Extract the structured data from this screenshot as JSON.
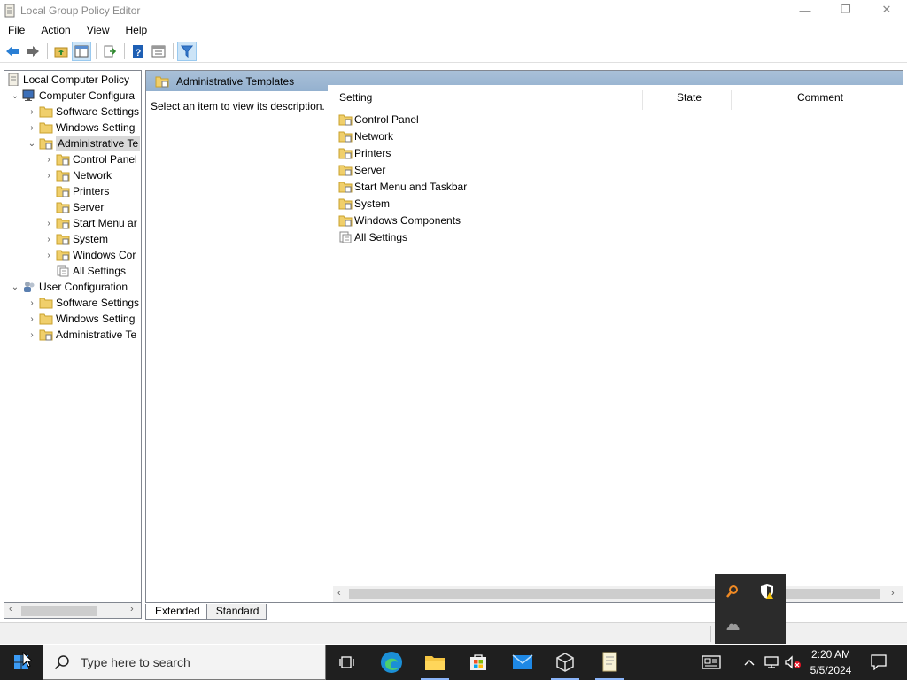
{
  "window": {
    "title": "Local Group Policy Editor",
    "minimize": "—",
    "restore": "❐",
    "close": "✕"
  },
  "menu": [
    "File",
    "Action",
    "View",
    "Help"
  ],
  "tree": {
    "items": [
      {
        "label": "Local Computer Policy",
        "expander": ""
      },
      {
        "label": "Computer Configura",
        "expander": "⌄"
      },
      {
        "label": "Software Settings",
        "expander": "›"
      },
      {
        "label": "Windows Setting",
        "expander": "›"
      },
      {
        "label": "Administrative Te",
        "expander": "⌄"
      },
      {
        "label": "Control Panel",
        "expander": "›"
      },
      {
        "label": "Network",
        "expander": "›"
      },
      {
        "label": "Printers",
        "expander": ""
      },
      {
        "label": "Server",
        "expander": ""
      },
      {
        "label": "Start Menu ar",
        "expander": "›"
      },
      {
        "label": "System",
        "expander": "›"
      },
      {
        "label": "Windows Cor",
        "expander": "›"
      },
      {
        "label": "All Settings",
        "expander": ""
      },
      {
        "label": "User Configuration",
        "expander": "⌄"
      },
      {
        "label": "Software Settings",
        "expander": "›"
      },
      {
        "label": "Windows Setting",
        "expander": "›"
      },
      {
        "label": "Administrative Te",
        "expander": "›"
      }
    ]
  },
  "right_pane": {
    "header_title": "Administrative Templates",
    "description": "Select an item to view its description.",
    "columns": {
      "setting": "Setting",
      "state": "State",
      "comment": "Comment"
    },
    "rows": [
      "Control Panel",
      "Network",
      "Printers",
      "Server",
      "Start Menu and Taskbar",
      "System",
      "Windows Components",
      "All Settings"
    ]
  },
  "tabs": {
    "extended": "Extended",
    "standard": "Standard"
  },
  "taskbar": {
    "search_placeholder": "Type here to search",
    "clock_time": "2:20 AM",
    "clock_date": "5/5/2024"
  },
  "colors": {
    "header_blue": "#9fbad6",
    "taskbar": "#1f1f1f",
    "selection": "#d9d9d9"
  }
}
